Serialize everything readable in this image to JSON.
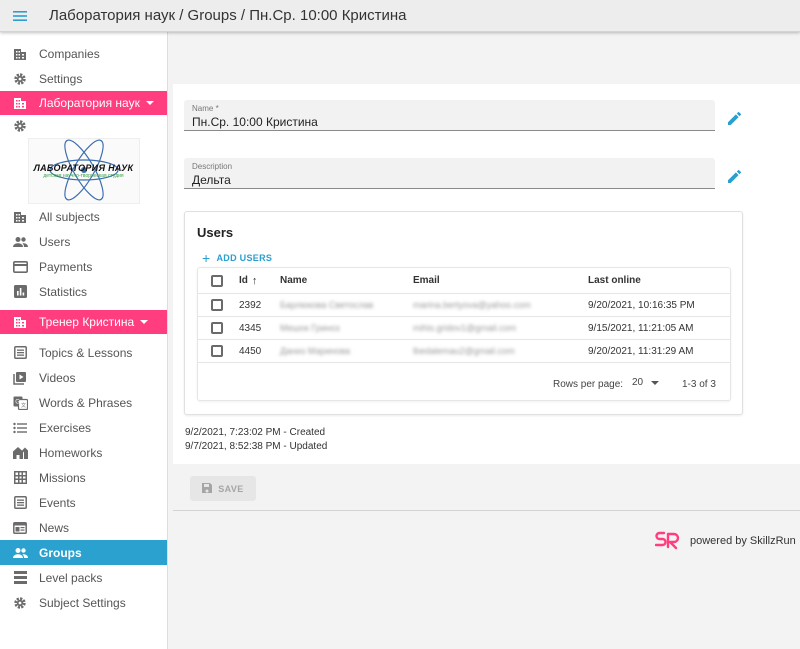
{
  "appbar": {
    "title": "Лаборатория наук / Groups / Пн.Ср. 10:00 Кристина"
  },
  "sidebar": {
    "top_items": [
      {
        "label": "Companies",
        "icon": "building-icon"
      },
      {
        "label": "Settings",
        "icon": "gear-icon"
      }
    ],
    "company_header": "Лаборатория наук",
    "logo": {
      "title": "ЛАБОРАТОРИЯ НАУК",
      "subtitle": "детская научно-творческая студия"
    },
    "company_items": [
      {
        "label": "All subjects",
        "icon": "building-icon"
      },
      {
        "label": "Users",
        "icon": "people-icon"
      },
      {
        "label": "Payments",
        "icon": "card-icon"
      },
      {
        "label": "Statistics",
        "icon": "chart-icon"
      }
    ],
    "subject_header": "Тренер Кристина",
    "subject_items": [
      {
        "label": "Topics & Lessons",
        "icon": "list-icon"
      },
      {
        "label": "Videos",
        "icon": "video-icon"
      },
      {
        "label": "Words & Phrases",
        "icon": "translate-icon"
      },
      {
        "label": "Exercises",
        "icon": "bullets-icon"
      },
      {
        "label": "Homeworks",
        "icon": "house-icon"
      },
      {
        "label": "Missions",
        "icon": "grid-icon"
      },
      {
        "label": "Events",
        "icon": "list-icon"
      },
      {
        "label": "News",
        "icon": "news-icon"
      },
      {
        "label": "Groups",
        "icon": "people-icon",
        "active": true
      },
      {
        "label": "Level packs",
        "icon": "layers-icon"
      },
      {
        "label": "Subject Settings",
        "icon": "gear-icon"
      }
    ]
  },
  "form": {
    "name": {
      "label": "Name *",
      "value": "Пн.Ср. 10:00 Кристина"
    },
    "description": {
      "label": "Description",
      "value": "Дельта"
    }
  },
  "users": {
    "title": "Users",
    "add_label": "ADD USERS",
    "columns": {
      "id": "Id",
      "name": "Name",
      "email": "Email",
      "last_online": "Last online"
    },
    "rows": [
      {
        "id": "2392",
        "name": "Барлюкова Светослав",
        "email": "marina.bertyova@yahoo.com",
        "last_online": "9/20/2021, 10:16:35 PM"
      },
      {
        "id": "4345",
        "name": "Мешок Гриноз",
        "email": "mihis.gridov1@gmail.com",
        "last_online": "9/15/2021, 11:21:05 AM"
      },
      {
        "id": "4450",
        "name": "Даниз Маринова",
        "email": "lbedalemau2@gmail.com",
        "last_online": "9/20/2021, 11:31:29 AM"
      }
    ],
    "rows_per_page_label": "Rows per page:",
    "rows_per_page": "20",
    "range": "1-3 of 3"
  },
  "timestamps": {
    "created": "9/2/2021, 7:23:02 PM - Created",
    "updated": "9/7/2021, 8:52:38 PM - Updated"
  },
  "save_label": "SAVE",
  "brand": "powered by SkillzRun",
  "colors": {
    "header_pink": "#ff3d7f",
    "active_blue": "#2aa1cf",
    "accent": "#2a9fd0",
    "brand_pink": "#ff3d7f"
  }
}
